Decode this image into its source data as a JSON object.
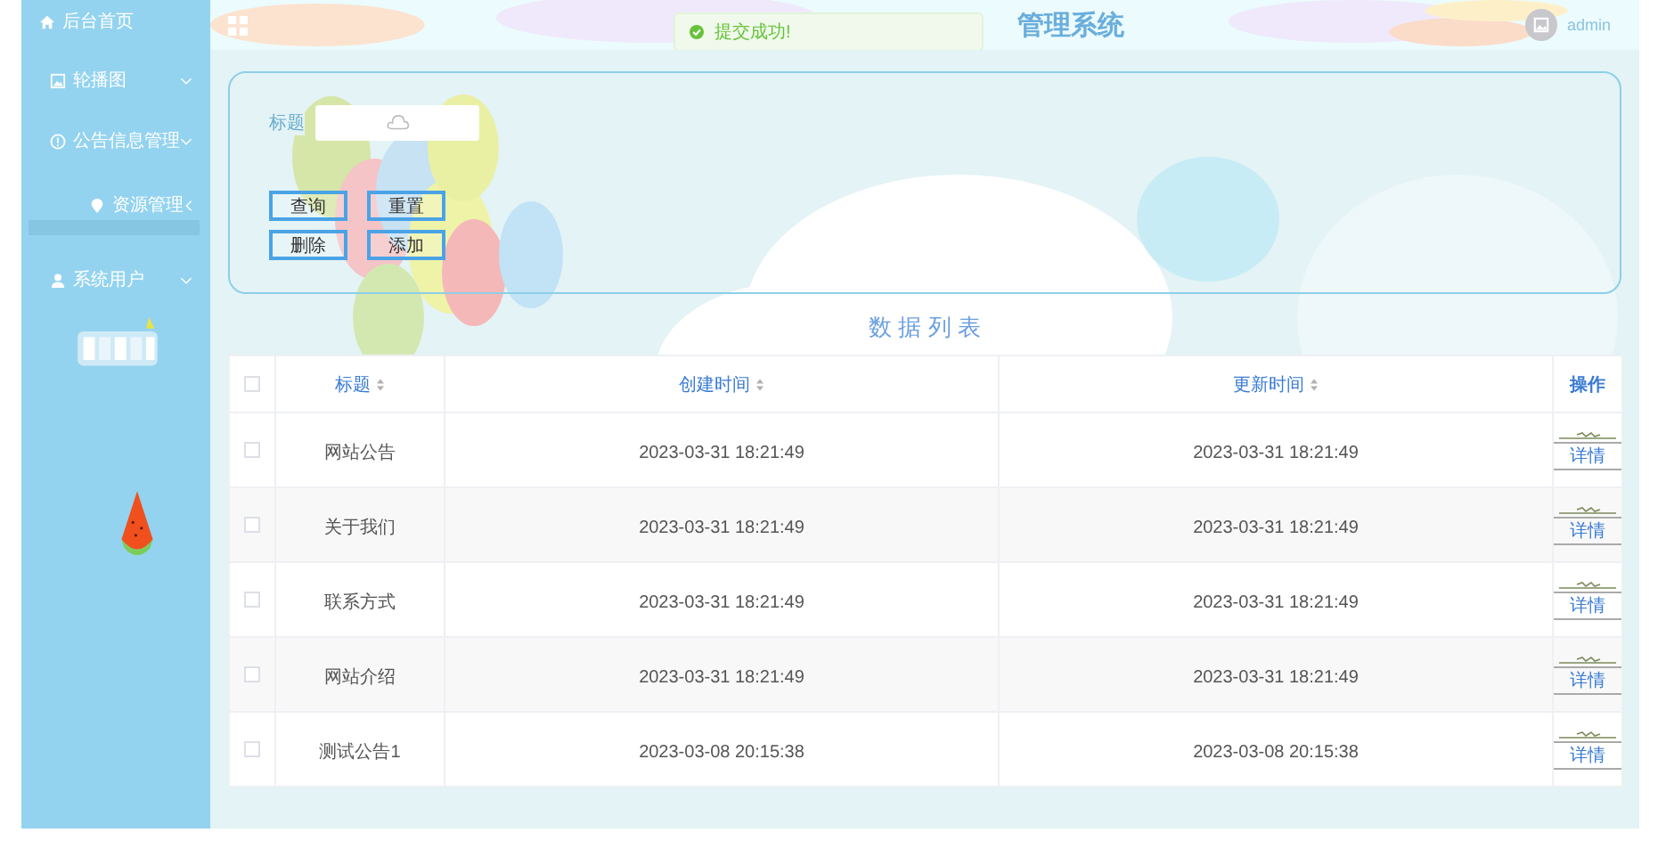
{
  "sidebar": {
    "items": [
      {
        "label": "后台首页",
        "kind": "link",
        "selected": false
      },
      {
        "label": "轮播图",
        "kind": "submenu",
        "selected": false
      },
      {
        "label": "公告信息管理",
        "kind": "submenu",
        "selected": false
      },
      {
        "label": "资源管理",
        "kind": "submenu",
        "selected": true
      },
      {
        "label": "系统用户",
        "kind": "submenu",
        "selected": false
      }
    ]
  },
  "header": {
    "title": "管理系统",
    "user": "admin"
  },
  "toast": {
    "message": "提交成功!"
  },
  "search": {
    "label": "标题",
    "buttons": [
      "查询",
      "重置",
      "删除",
      "添加"
    ]
  },
  "table": {
    "heading": "数 据 列 表",
    "columns": [
      {
        "label": "标题",
        "sortable": true
      },
      {
        "label": "创建时间",
        "sortable": true
      },
      {
        "label": "更新时间",
        "sortable": true
      },
      {
        "label": "操作",
        "sortable": false
      }
    ],
    "header_checked": false,
    "rows": [
      {
        "checked": false,
        "title": "网站公告",
        "created": "2023-03-31 18:21:49",
        "updated": "2023-03-31 18:21:49",
        "action": "详情"
      },
      {
        "checked": false,
        "title": "关于我们",
        "created": "2023-03-31 18:21:49",
        "updated": "2023-03-31 18:21:49",
        "action": "详情"
      },
      {
        "checked": false,
        "title": "联系方式",
        "created": "2023-03-31 18:21:49",
        "updated": "2023-03-31 18:21:49",
        "action": "详情"
      },
      {
        "checked": false,
        "title": "网站介绍",
        "created": "2023-03-31 18:21:49",
        "updated": "2023-03-31 18:21:49",
        "action": "详情"
      },
      {
        "checked": false,
        "title": "测试公告1",
        "created": "2023-03-08 20:15:38",
        "updated": "2023-03-08 20:15:38",
        "action": "详情"
      }
    ]
  }
}
